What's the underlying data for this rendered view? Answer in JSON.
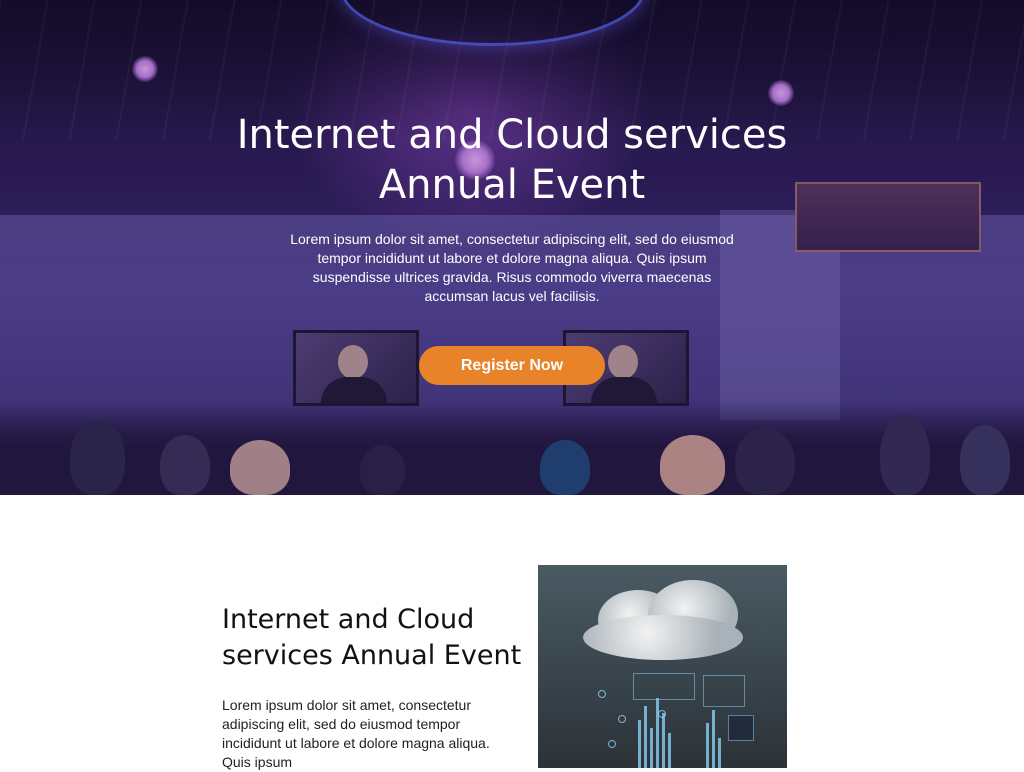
{
  "hero": {
    "title_line1": "Internet and Cloud services",
    "title_line2": "Annual Event",
    "description": "Lorem ipsum dolor sit amet, consectetur adipiscing elit, sed do eiusmod tempor incididunt ut labore et dolore magna aliqua. Quis ipsum suspendisse ultrices gravida. Risus commodo viverra maecenas accumsan lacus vel facilisis.",
    "register_label": "Register Now"
  },
  "about": {
    "title_line1": "Internet and Cloud",
    "title_line2": "services Annual Event",
    "description": "Lorem ipsum dolor sit amet, consectetur adipiscing elit, sed do eiusmod tempor incididunt ut labore et dolore magna aliqua. Quis ipsum"
  },
  "colors": {
    "accent": "#e8832a",
    "hero_tint": "#2a1d4f",
    "text_dark": "#111111"
  }
}
